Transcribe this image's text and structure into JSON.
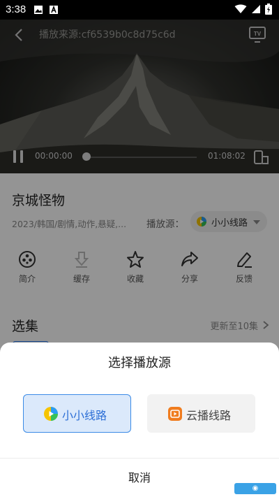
{
  "status_bar": {
    "time": "3:38"
  },
  "player": {
    "source_title": "播放来源:cf6539b0c8d75c6d",
    "current_time": "00:00:00",
    "total_time": "01:08:02",
    "progress": 0
  },
  "video": {
    "title": "京城怪物",
    "meta": "2023/韩国/剧情,动作,悬疑,...",
    "source_label": "播放源：",
    "selected_source": "小小线路"
  },
  "actions": [
    {
      "label": "简介",
      "icon": "film-reel-icon"
    },
    {
      "label": "缓存",
      "icon": "download-icon"
    },
    {
      "label": "收藏",
      "icon": "star-icon"
    },
    {
      "label": "分享",
      "icon": "share-icon"
    },
    {
      "label": "反馈",
      "icon": "edit-icon"
    }
  ],
  "episodes": {
    "title": "选集",
    "update_text": "更新至10集"
  },
  "sheet": {
    "title": "选择播放源",
    "options": [
      {
        "name": "小小线路",
        "selected": true
      },
      {
        "name": "云播线路",
        "selected": false
      }
    ],
    "cancel": "取消"
  },
  "colors": {
    "accent": "#2d6fd6",
    "selected_bg": "#dbe9fb",
    "overlay": "rgba(0,0,0,0.42)"
  }
}
